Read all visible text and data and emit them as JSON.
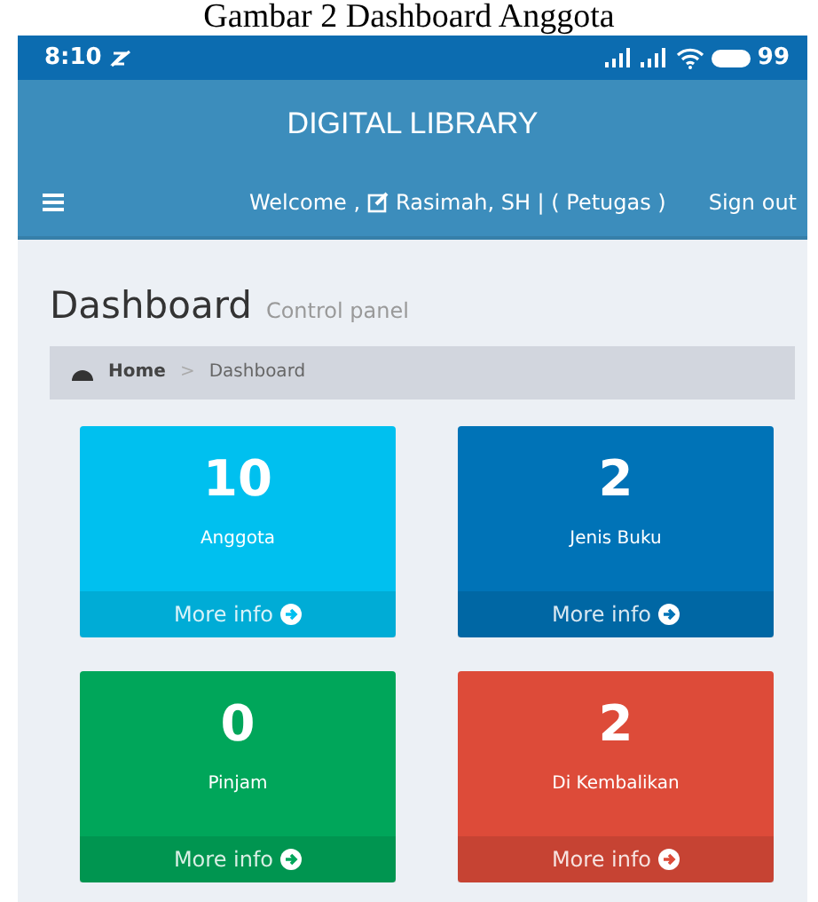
{
  "caption": "Gambar 2 Dashboard Anggota",
  "status_bar": {
    "time": "8:10",
    "battery": "99"
  },
  "app_title": "DIGITAL LIBRARY",
  "navbar": {
    "welcome": "Welcome ,",
    "user": "Rasimah, SH | ( Petugas )",
    "sign_out": "Sign out"
  },
  "page_header": {
    "title": "Dashboard",
    "subtitle": "Control panel"
  },
  "breadcrumb": [
    {
      "label": "Home",
      "selected": false
    },
    {
      "label": "Dashboard",
      "selected": true
    }
  ],
  "breadcrumb_separator": ">",
  "boxes": [
    {
      "value": "10",
      "label": "Anggota",
      "footer": "More info",
      "color": "#00c0ef"
    },
    {
      "value": "2",
      "label": "Jenis Buku",
      "footer": "More info",
      "color": "#0073b7"
    },
    {
      "value": "0",
      "label": "Pinjam",
      "footer": "More info",
      "color": "#00a65a"
    },
    {
      "value": "2",
      "label": "Di Kembalikan",
      "footer": "More info",
      "color": "#dd4b39"
    }
  ]
}
